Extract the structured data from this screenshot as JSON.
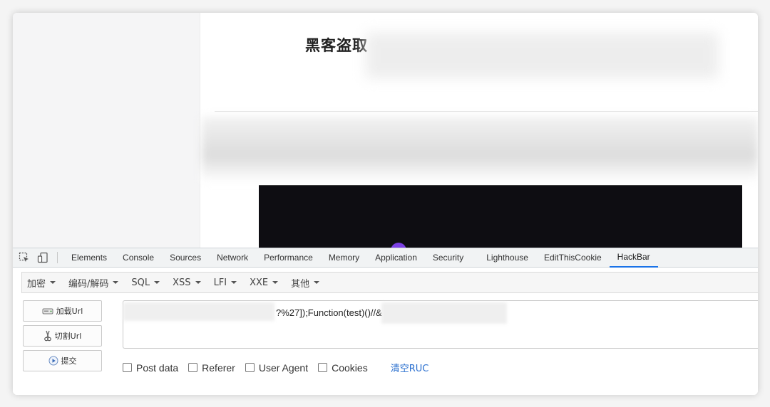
{
  "page": {
    "title": "黑客盗取"
  },
  "devtools": {
    "tabs": [
      "Elements",
      "Console",
      "Sources",
      "Network",
      "Performance",
      "Memory",
      "Application",
      "Security",
      "Lighthouse",
      "EditThisCookie",
      "HackBar"
    ],
    "active_tab": "HackBar"
  },
  "hackbar": {
    "menus": [
      "加密",
      "编码/解码",
      "SQL",
      "XSS",
      "LFI",
      "XXE",
      "其他"
    ],
    "buttons": {
      "load_url": "加载Url",
      "split_url": "切割Url",
      "execute": "提交"
    },
    "url_value": "?%27]);Function(test)()//&",
    "options": [
      "Post data",
      "Referer",
      "User Agent",
      "Cookies"
    ],
    "clear_link": "清空RUC"
  },
  "colors": {
    "accent": "#1a73e8",
    "link": "#2a6fcf",
    "video_bg": "#0e0d12"
  }
}
